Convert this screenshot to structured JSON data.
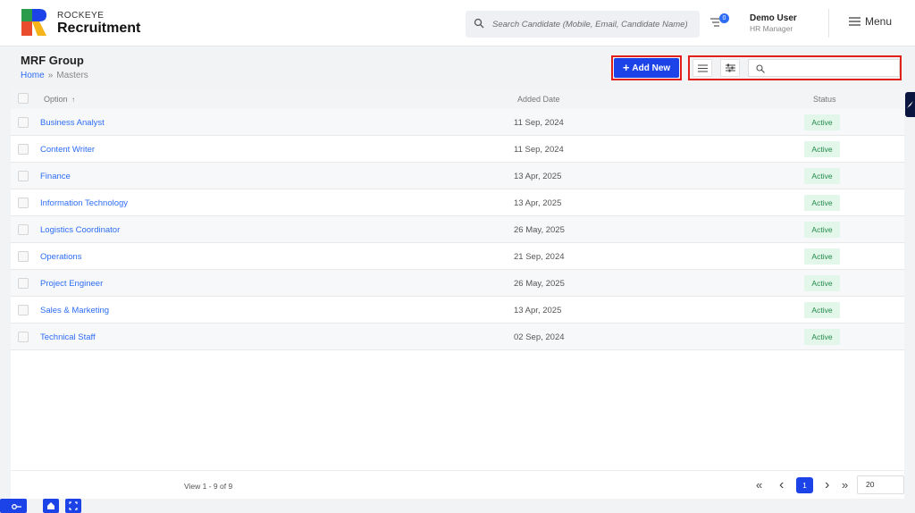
{
  "header": {
    "brand_small": "ROCKEYE",
    "brand_big": "Recruitment",
    "search_placeholder": "Search Candidate (Mobile, Email, Candidate Name)",
    "notification_count": "0",
    "user_name": "Demo User",
    "user_role": "HR Manager",
    "menu_label": "Menu"
  },
  "page": {
    "title": "MRF Group",
    "breadcrumb": {
      "home": "Home",
      "separator": "»",
      "current": "Masters"
    },
    "add_button": "Add New"
  },
  "table": {
    "headers": {
      "option": "Option",
      "sort_icon": "↑",
      "added_date": "Added Date",
      "status": "Status"
    },
    "rows": [
      {
        "option": "Business Analyst",
        "date": "11 Sep, 2024",
        "status": "Active"
      },
      {
        "option": "Content Writer",
        "date": "11 Sep, 2024",
        "status": "Active"
      },
      {
        "option": "Finance",
        "date": "13 Apr, 2025",
        "status": "Active"
      },
      {
        "option": "Information Technology",
        "date": "13 Apr, 2025",
        "status": "Active"
      },
      {
        "option": "Logistics Coordinator",
        "date": "26 May, 2025",
        "status": "Active"
      },
      {
        "option": "Operations",
        "date": "21 Sep, 2024",
        "status": "Active"
      },
      {
        "option": "Project Engineer",
        "date": "26 May, 2025",
        "status": "Active"
      },
      {
        "option": "Sales & Marketing",
        "date": "13 Apr, 2025",
        "status": "Active"
      },
      {
        "option": "Technical Staff",
        "date": "02 Sep, 2024",
        "status": "Active"
      }
    ]
  },
  "pagination": {
    "view_text": "View 1 - 9 of 9",
    "first": "«",
    "prev": "‹",
    "current_page": "1",
    "next": "›",
    "last": "»",
    "page_size": "20"
  },
  "colors": {
    "accent": "#1b43e8",
    "link": "#2d6df6",
    "highlight_border": "#e0201b",
    "status_bg": "#e3f6ea",
    "status_text": "#1f8a48"
  }
}
